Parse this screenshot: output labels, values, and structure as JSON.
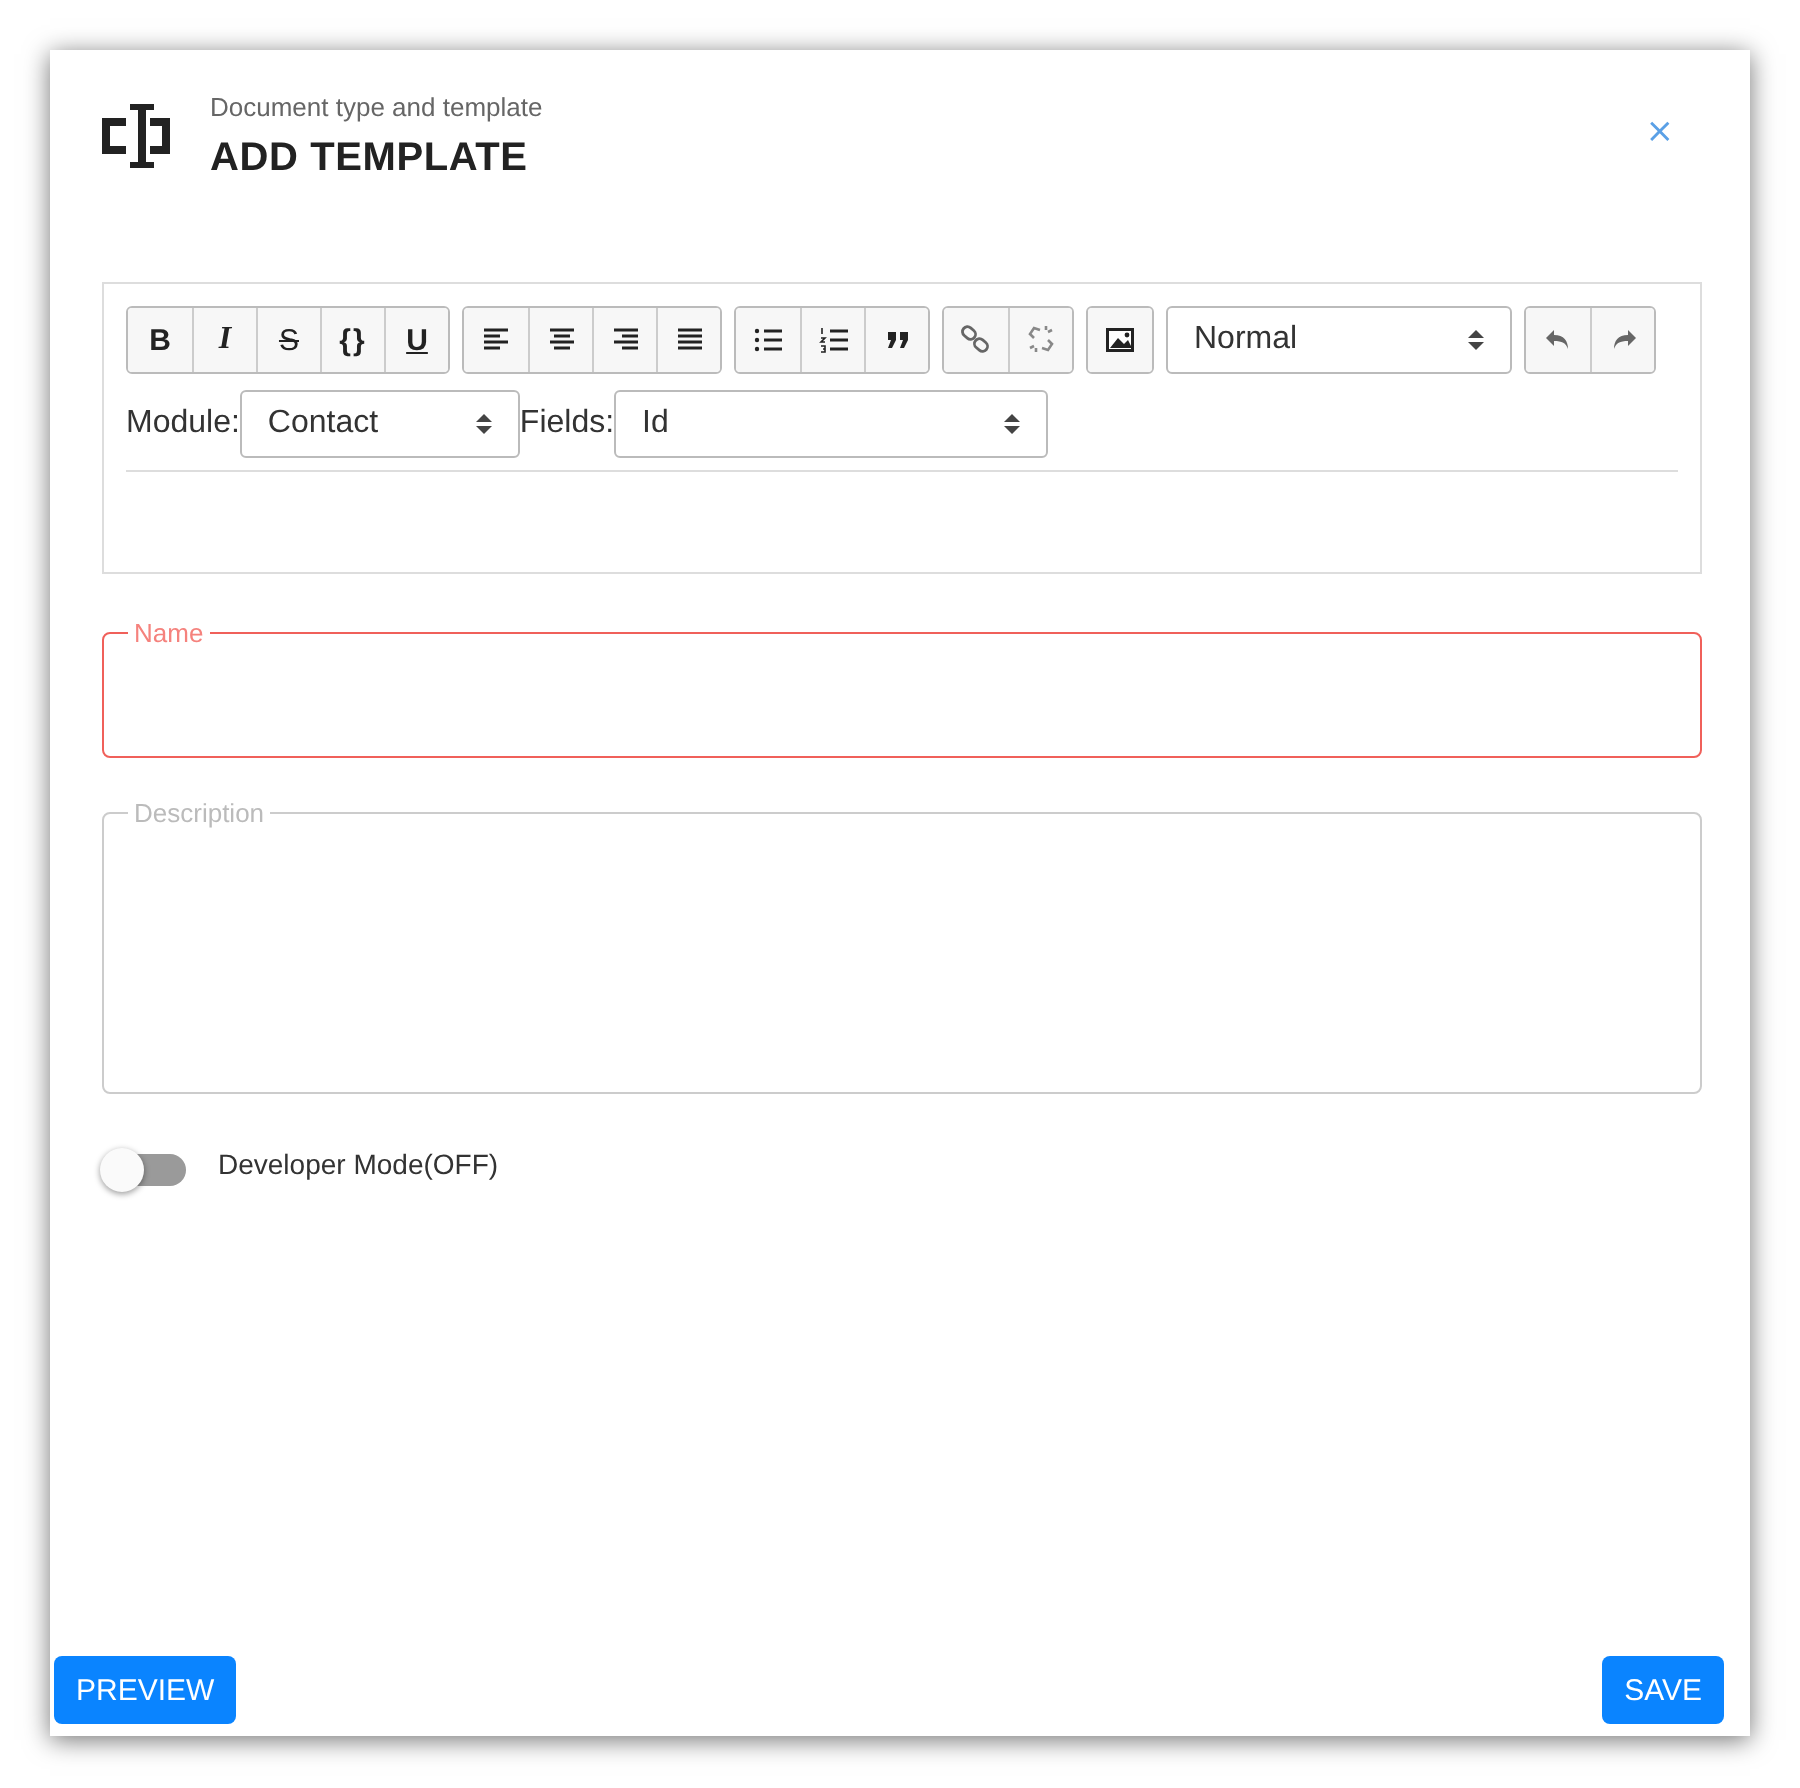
{
  "header": {
    "subtitle": "Document type and template",
    "title": "ADD TEMPLATE",
    "close": "×"
  },
  "toolbar": {
    "groups": [
      [
        {
          "kind": "bold",
          "label": "B"
        },
        {
          "kind": "italic",
          "label": "I"
        },
        {
          "kind": "strike",
          "label": "S"
        },
        {
          "kind": "code",
          "label": "{}"
        },
        {
          "kind": "underline",
          "label": "U"
        }
      ],
      [
        {
          "kind": "align-left"
        },
        {
          "kind": "align-center"
        },
        {
          "kind": "align-right"
        },
        {
          "kind": "justify"
        }
      ],
      [
        {
          "kind": "bullet-list"
        },
        {
          "kind": "ordered-list"
        },
        {
          "kind": "quote"
        }
      ],
      [
        {
          "kind": "link"
        },
        {
          "kind": "unlink"
        }
      ],
      [
        {
          "kind": "image"
        }
      ]
    ],
    "style_select": "Normal",
    "history": [
      {
        "kind": "undo"
      },
      {
        "kind": "redo"
      }
    ]
  },
  "module": {
    "label": "Module:",
    "value": "Contact"
  },
  "fields": {
    "label": "Fields:",
    "value": "Id"
  },
  "inputs": [
    {
      "label": "Name",
      "error": true,
      "kind": "line"
    },
    {
      "label": "Description",
      "error": false,
      "kind": "area"
    }
  ],
  "developer_mode": {
    "label": "Developer Mode(OFF)",
    "on": false
  },
  "buttons": [
    {
      "label": "PREVIEW"
    },
    {
      "label": "SAVE"
    }
  ]
}
